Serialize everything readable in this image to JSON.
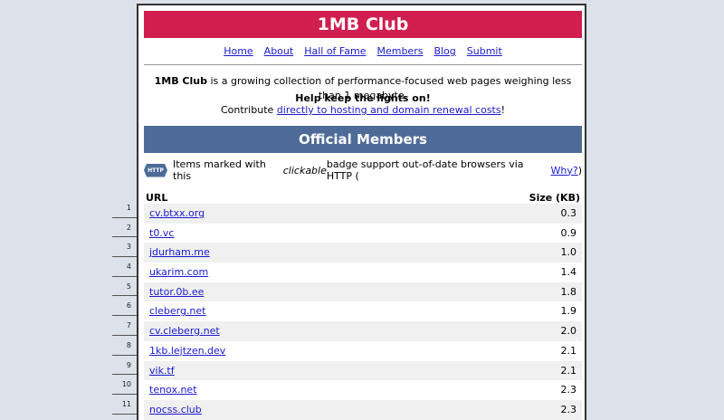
{
  "header": {
    "title": "1MB Club"
  },
  "nav": [
    {
      "label": "Home"
    },
    {
      "label": "About"
    },
    {
      "label": "Hall of Fame"
    },
    {
      "label": "Members"
    },
    {
      "label": "Blog"
    },
    {
      "label": "Submit"
    }
  ],
  "intro": {
    "brand": "1MB Club",
    "text": " is a growing collection of performance-focused web pages weighing less than 1 megabyte."
  },
  "support": {
    "heading": "Help keep the lights on!",
    "prefix": "Contribute ",
    "link": "directly to hosting and domain renewal costs",
    "suffix": "!"
  },
  "members": {
    "title": "Official Members",
    "badge_label": "HTTP",
    "note_prefix": "Items marked with this ",
    "note_em": "clickable",
    "note_suffix": " badge support out-of-date browsers via HTTP (",
    "note_link": "Why?",
    "note_end": ")"
  },
  "table": {
    "col_url": "URL",
    "col_size": "Size (KB)",
    "rows": [
      {
        "n": "1",
        "url": "cv.btxx.org",
        "size": "0.3"
      },
      {
        "n": "2",
        "url": "t0.vc",
        "size": "0.9"
      },
      {
        "n": "3",
        "url": "jdurham.me",
        "size": "1.0"
      },
      {
        "n": "4",
        "url": "ukarim.com",
        "size": "1.4"
      },
      {
        "n": "5",
        "url": "tutor.0b.ee",
        "size": "1.8"
      },
      {
        "n": "6",
        "url": "cleberg.net",
        "size": "1.9"
      },
      {
        "n": "7",
        "url": "cv.cleberg.net",
        "size": "2.0"
      },
      {
        "n": "8",
        "url": "1kb.lejtzen.dev",
        "size": "2.1"
      },
      {
        "n": "9",
        "url": "vik.tf",
        "size": "2.1"
      },
      {
        "n": "10",
        "url": "tenox.net",
        "size": "2.3"
      },
      {
        "n": "11",
        "url": "nocss.club",
        "size": "2.3"
      }
    ]
  }
}
